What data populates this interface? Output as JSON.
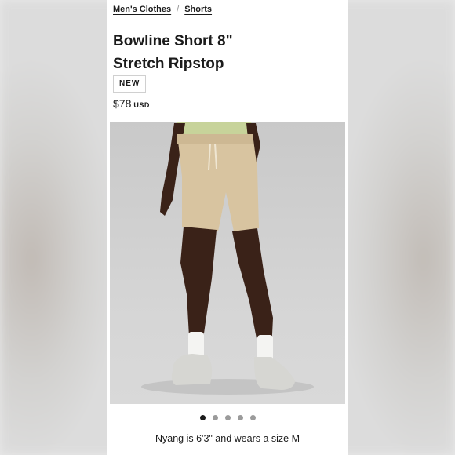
{
  "breadcrumb": {
    "items": [
      "Men's Clothes",
      "Shorts"
    ],
    "separator": "/"
  },
  "product": {
    "title_line1": "Bowline Short 8\"",
    "title_line2": "Stretch Ripstop",
    "badge": "NEW",
    "price": "$78",
    "currency": "USD",
    "image_icon": "product-photo-shorts",
    "colors": {
      "shorts": "#d8c4a0",
      "shirt": "#c7d39a",
      "skin": "#3a2218",
      "sock": "#f4f4f2",
      "shoe": "#d6d6d2"
    }
  },
  "carousel": {
    "dot_count": 5,
    "active_index": 0
  },
  "caption": "Nyang is 6'3\" and wears a size M"
}
